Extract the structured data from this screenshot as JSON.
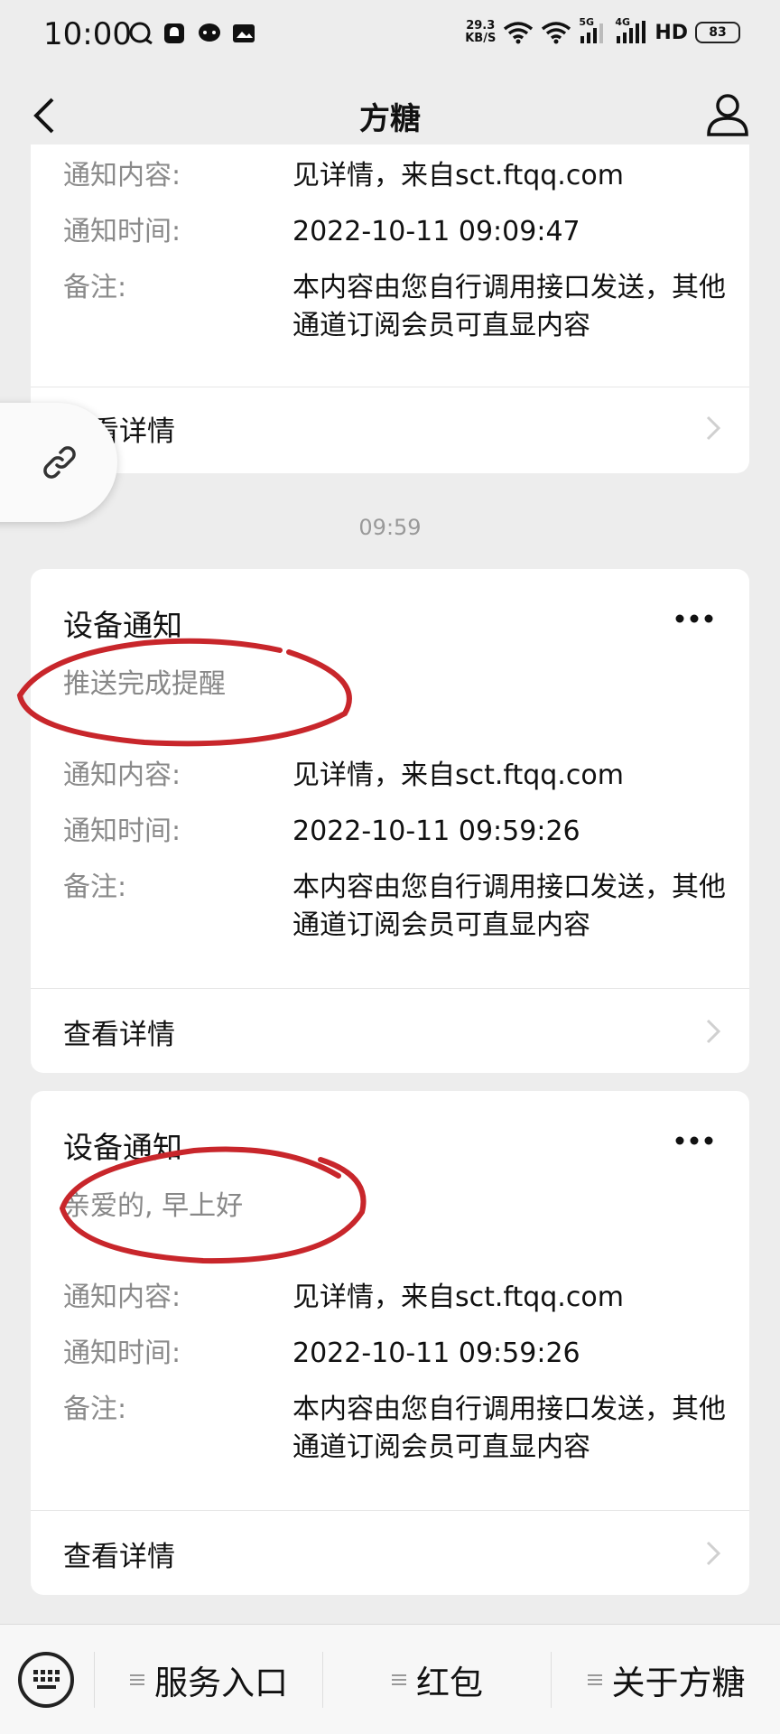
{
  "status_bar": {
    "time": "10:00",
    "net_speed_value": "29.3",
    "net_speed_unit": "KB/S",
    "signal_5g": "5G",
    "signal_4g": "4G",
    "hd": "HD",
    "battery": "83"
  },
  "nav": {
    "title": "方糖"
  },
  "cards": [
    {
      "rows": [
        {
          "label": "通知内容:",
          "value": "见详情，来自sct.ftqq.com"
        },
        {
          "label": "通知时间:",
          "value": "2022-10-11 09:09:47"
        },
        {
          "label": "备注:",
          "value": "本内容由您自行调用接口发送，其他通道订阅会员可直显内容"
        }
      ],
      "detail_label": "查看详情"
    },
    {
      "title": "设备通知",
      "subtitle": "推送完成提醒",
      "rows": [
        {
          "label": "通知内容:",
          "value": "见详情，来自sct.ftqq.com"
        },
        {
          "label": "通知时间:",
          "value": "2022-10-11 09:59:26"
        },
        {
          "label": "备注:",
          "value": "本内容由您自行调用接口发送，其他通道订阅会员可直显内容"
        }
      ],
      "detail_label": "查看详情"
    },
    {
      "title": "设备通知",
      "subtitle": "亲爱的, 早上好",
      "rows": [
        {
          "label": "通知内容:",
          "value": "见详情，来自sct.ftqq.com"
        },
        {
          "label": "通知时间:",
          "value": "2022-10-11 09:59:26"
        },
        {
          "label": "备注:",
          "value": "本内容由您自行调用接口发送，其他通道订阅会员可直显内容"
        }
      ],
      "detail_label": "查看详情"
    }
  ],
  "timestamp": "09:59",
  "bottom_menu": {
    "items": [
      "服务入口",
      "红包",
      "关于方糖"
    ]
  },
  "colors": {
    "background": "#ededed",
    "card": "#ffffff",
    "label_gray": "#8a8a8a",
    "annotation_red": "#c8262b"
  }
}
